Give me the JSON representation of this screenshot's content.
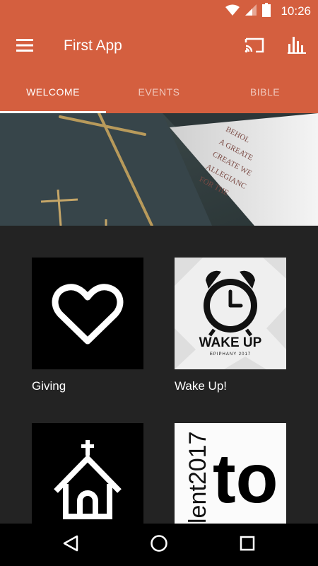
{
  "status_bar": {
    "time": "10:26",
    "icons": [
      "wifi-icon",
      "cell-signal-icon",
      "battery-icon"
    ]
  },
  "app_bar": {
    "title": "First App",
    "menu_icon": "hamburger-menu-icon",
    "cast_icon": "cast-icon",
    "stats_icon": "bar-chart-icon"
  },
  "tabs": [
    {
      "label": "WELCOME",
      "active": true
    },
    {
      "label": "EVENTS",
      "active": false
    },
    {
      "label": "BIBLE",
      "active": false
    }
  ],
  "banner": {
    "image": "church-altar-cross-photo",
    "text_lines": [
      "BEHOL",
      "A GREATE",
      "CREATE WE",
      "ALLEGIANC",
      "FOR THE"
    ]
  },
  "tiles": [
    {
      "label": "Giving",
      "icon": "heart-icon"
    },
    {
      "label": "Wake Up!",
      "icon": "alarm-clock-icon",
      "image_text": "WAKE UP",
      "image_subtext": "EPIPHANY 2017"
    },
    {
      "label": "",
      "icon": "church-icon"
    },
    {
      "label": "",
      "icon": "lent-2017-logo",
      "image_text": "lent2017",
      "image_subtext": "to"
    }
  ],
  "nav_bar": {
    "back_icon": "back-triangle-icon",
    "home_icon": "home-circle-icon",
    "recents_icon": "recents-square-icon"
  },
  "colors": {
    "accent": "#d45f3f",
    "background": "#232323",
    "text": "#ffffff"
  }
}
